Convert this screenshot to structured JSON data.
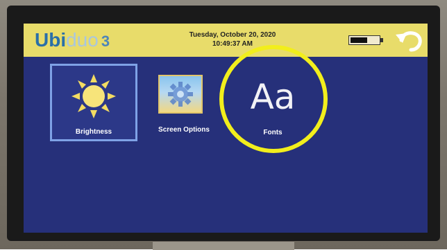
{
  "header": {
    "logo": {
      "brand": "Ubi",
      "brand_faded": "duo",
      "version": "3"
    },
    "date": "Tuesday, October 20, 2020",
    "time": "10:49:37 AM",
    "battery_level": 0.6,
    "back_icon": "undo-arrow-icon"
  },
  "tiles": [
    {
      "label": "Brightness",
      "icon": "sun-icon",
      "selected": true
    },
    {
      "label": "Screen Options",
      "icon": "gear-icon",
      "selected": false
    },
    {
      "label": "Fonts",
      "glyph": "Aa",
      "icon": "fonts-icon",
      "selected": false
    }
  ],
  "colors": {
    "screen_bg": "#26307a",
    "header_bg": "#e8dc6a",
    "highlight_circle": "#f2ee1c",
    "selected_border": "#7fa2e6"
  }
}
